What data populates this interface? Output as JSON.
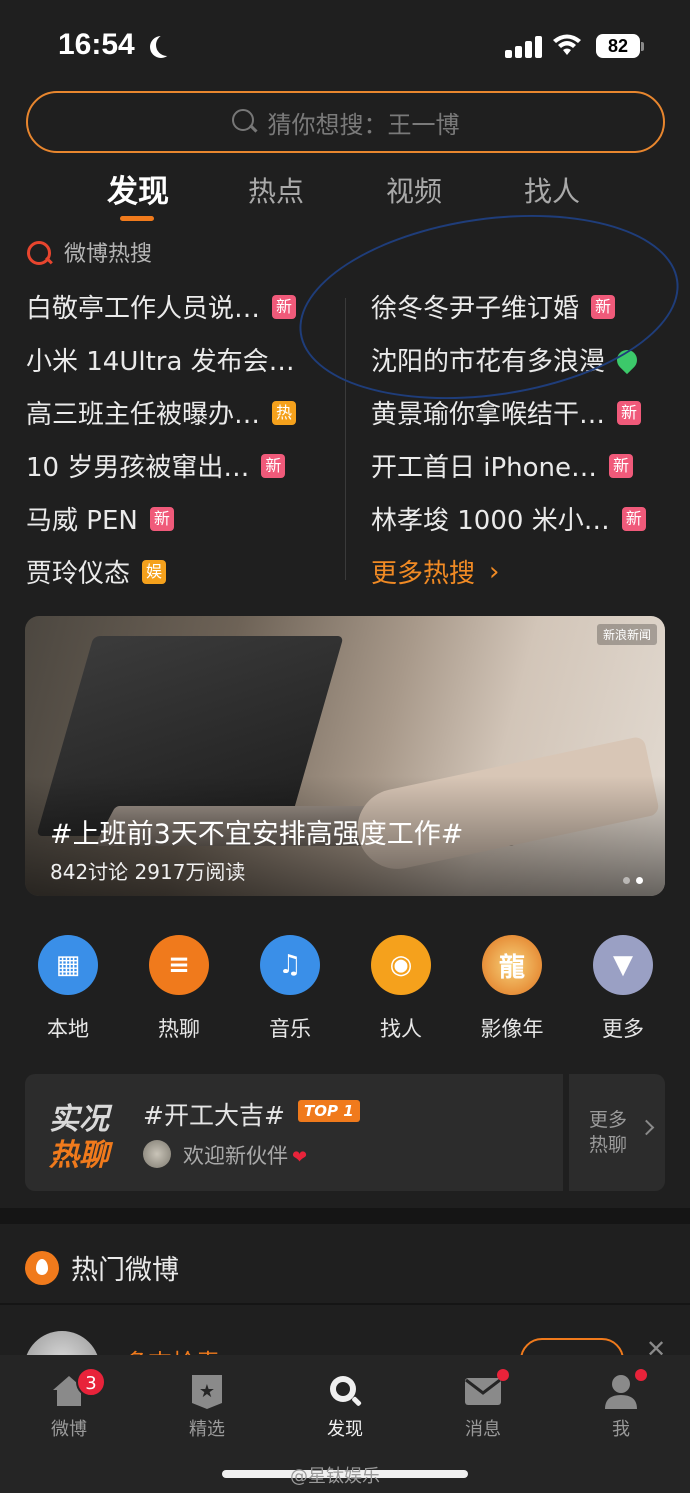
{
  "status_bar": {
    "time": "16:54",
    "battery": "82"
  },
  "search": {
    "placeholder": "猜你想搜：王一博"
  },
  "tabs": [
    {
      "label": "发现",
      "active": true
    },
    {
      "label": "热点"
    },
    {
      "label": "视频"
    },
    {
      "label": "找人"
    }
  ],
  "hot_search": {
    "title": "微博热搜",
    "left": [
      {
        "text": "白敬亭工作人员说…",
        "badge": "新"
      },
      {
        "text": "小米 14Ultra 发布会…",
        "badge": ""
      },
      {
        "text": "高三班主任被曝办…",
        "badge": "热"
      },
      {
        "text": "10 岁男孩被窜出…",
        "badge": "新"
      },
      {
        "text": "马威 PEN",
        "badge": "新"
      },
      {
        "text": "贾玲仪态",
        "badge": "娱"
      }
    ],
    "right": [
      {
        "text": "徐冬冬尹子维订婚",
        "badge": "新"
      },
      {
        "text": "沈阳的市花有多浪漫",
        "badge": "location"
      },
      {
        "text": "黄景瑜你拿喉结干…",
        "badge": "新"
      },
      {
        "text": "开工首日 iPhone…",
        "badge": "新"
      },
      {
        "text": "林孝埈 1000 米小…",
        "badge": "新"
      }
    ],
    "more": "更多热搜"
  },
  "banner": {
    "source": "新浪新闻",
    "title": "#上班前3天不宜安排高强度工作#",
    "stats": "842讨论  2917万阅读"
  },
  "entries": [
    {
      "label": "本地",
      "icon": "building-icon",
      "color": "#3a8fe8"
    },
    {
      "label": "热聊",
      "icon": "chat-icon",
      "color": "#f07a1c"
    },
    {
      "label": "音乐",
      "icon": "music-icon",
      "color": "#3a8fe8"
    },
    {
      "label": "找人",
      "icon": "person-search-icon",
      "color": "#f5a11c"
    },
    {
      "label": "影像年",
      "icon": "dragon-icon",
      "color": "#f5b84a"
    },
    {
      "label": "更多",
      "icon": "chevron-down-icon",
      "color": "#9aa0c4"
    }
  ],
  "live": {
    "tag_line1": "实况",
    "tag_line2": "热聊",
    "topic": "#开工大吉#",
    "rank": "TOP 1",
    "subtitle": "欢迎新伙伴",
    "more": "更多热聊"
  },
  "hot_weibo": {
    "title": "热门微博"
  },
  "feed": {
    "name": "多吉拾青"
  },
  "bottom_nav": [
    {
      "label": "微博",
      "badge": "3"
    },
    {
      "label": "精选"
    },
    {
      "label": "发现",
      "active": true
    },
    {
      "label": "消息"
    },
    {
      "label": "我"
    }
  ],
  "watermark": "@星钛娱乐"
}
